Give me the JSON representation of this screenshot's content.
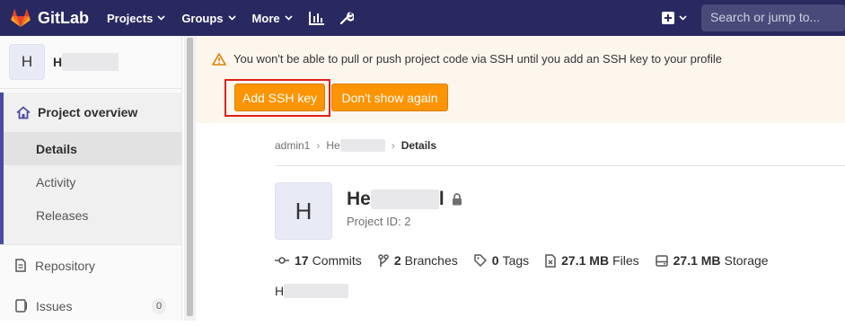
{
  "topbar": {
    "brand": "GitLab",
    "nav": [
      {
        "label": "Projects"
      },
      {
        "label": "Groups"
      },
      {
        "label": "More"
      }
    ],
    "search_placeholder": "Search or jump to..."
  },
  "sidebar": {
    "avatar_letter": "H",
    "project_name_visible": "H",
    "overview_label": "Project overview",
    "sub_items": [
      "Details",
      "Activity",
      "Releases"
    ],
    "repository_label": "Repository",
    "issues_label": "Issues",
    "issues_count": "0"
  },
  "alert": {
    "message": "You won't be able to pull or push project code via SSH until you add an SSH key to your profile",
    "add_key_label": "Add SSH key",
    "dont_show_label": "Don't show again"
  },
  "breadcrumb": {
    "items": [
      "admin1",
      "He",
      "Details"
    ]
  },
  "project": {
    "avatar_letter": "H",
    "title_visible": "He",
    "title_tail": "l",
    "id_text": "Project ID: 2",
    "stats": [
      {
        "value": "17",
        "label": "Commits"
      },
      {
        "value": "2",
        "label": "Branches"
      },
      {
        "value": "0",
        "label": "Tags"
      },
      {
        "value": "27.1 MB",
        "label": "Files"
      },
      {
        "value": "27.1 MB",
        "label": "Storage"
      }
    ],
    "description_visible": "H"
  },
  "colors": {
    "topbar": "#292961",
    "accent": "#4b4ba3",
    "warning_button": "#fc9403",
    "alert_bg": "#fdf6ed",
    "highlight": "#e0201a"
  }
}
